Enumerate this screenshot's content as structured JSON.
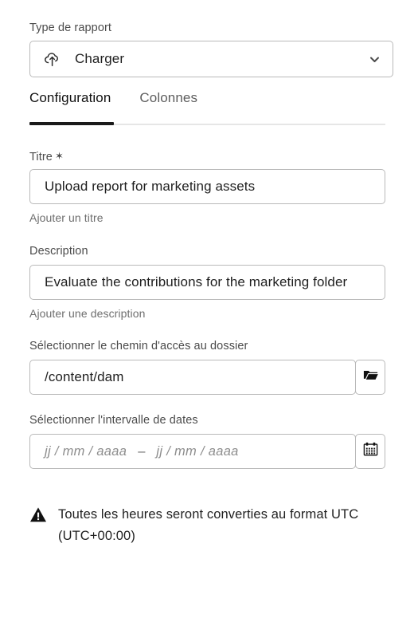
{
  "report_type": {
    "label": "Type de rapport",
    "selected": "Charger",
    "icon": "cloud-upload-icon",
    "chevron": "chevron-down-icon"
  },
  "tabs": [
    {
      "label": "Configuration",
      "active": true
    },
    {
      "label": "Colonnes",
      "active": false
    }
  ],
  "title_field": {
    "label": "Titre",
    "required_marker": "✶",
    "value": "Upload report for marketing assets",
    "helper": "Ajouter un titre"
  },
  "description_field": {
    "label": "Description",
    "value": "Evaluate the contributions for the marketing folder",
    "helper": "Ajouter une description"
  },
  "folder_path_field": {
    "label": "Sélectionner le chemin d'accès au dossier",
    "value": "/content/dam",
    "button_icon": "folder-icon"
  },
  "date_range_field": {
    "label": "Sélectionner l'intervalle de dates",
    "start_placeholder": "jj / mm / aaaa",
    "separator": "–",
    "end_placeholder": "jj / mm / aaaa",
    "button_icon": "calendar-icon"
  },
  "warning": {
    "icon": "warning-triangle-icon",
    "text": "Toutes les heures seront converties au format UTC (UTC+00:00)"
  },
  "colors": {
    "accent": "#1a1a1a",
    "border": "#b9b9b9",
    "label": "#4b4b4b",
    "helper": "#6e6e6e",
    "placeholder": "#8d8d8d",
    "background": "#ffffff"
  }
}
